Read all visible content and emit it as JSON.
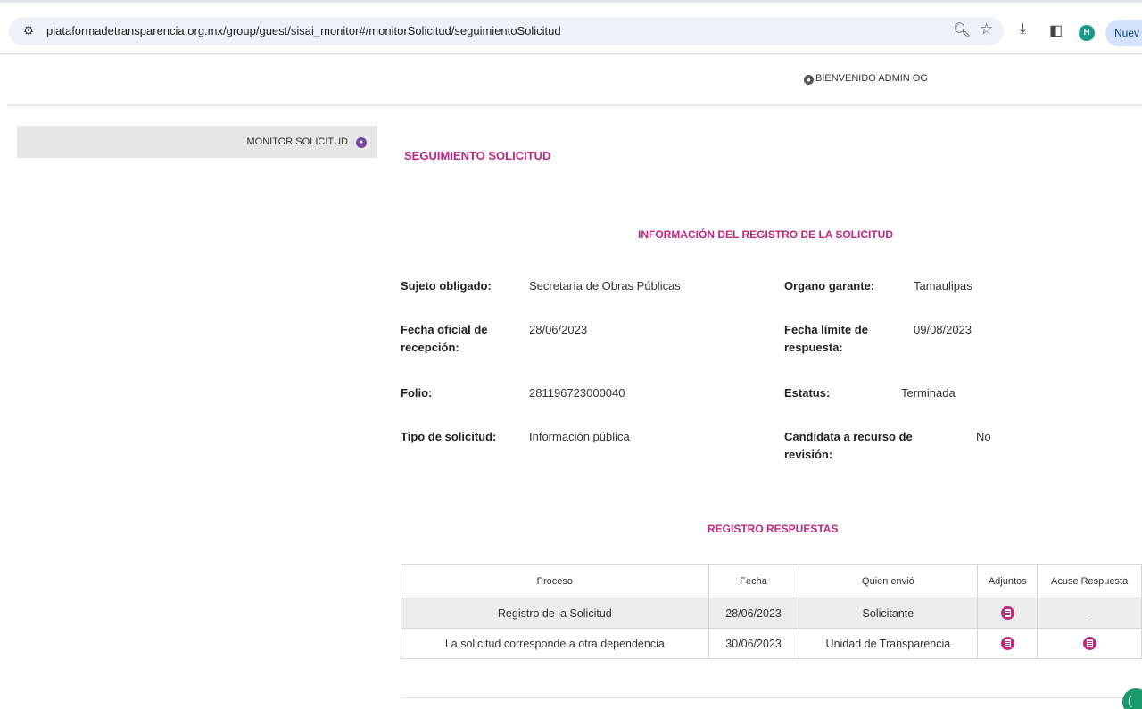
{
  "browser": {
    "url": "plataformadetransparencia.org.mx/group/guest/sisai_monitor#/monitorSolicitud/seguimientoSolicitud",
    "profile_initial": "H",
    "new_button_label": "Nuev"
  },
  "header": {
    "welcome": "BIENVENIDO ADMIN OG"
  },
  "sidebar": {
    "items": [
      {
        "label": "MONITOR SOLICITUD"
      }
    ]
  },
  "main": {
    "title": "SEGUIMIENTO SOLICITUD",
    "info_title": "INFORMACIÓN DEL REGISTRO DE LA SOLICITUD",
    "fields": {
      "sujeto_obligado": {
        "label": "Sujeto obligado:",
        "value": "Secretaría de Obras Públicas"
      },
      "organo_garante": {
        "label": "Organo garante:",
        "value": "Tamaulipas"
      },
      "fecha_oficial": {
        "label": "Fecha oficial de recepción:",
        "value": "28/06/2023"
      },
      "fecha_limite": {
        "label": "Fecha límite de respuesta:",
        "value": "09/08/2023"
      },
      "folio": {
        "label": "Folio:",
        "value": "281196723000040"
      },
      "estatus": {
        "label": "Estatus:",
        "value": "Terminada"
      },
      "tipo_solicitud": {
        "label": "Tipo de solicitud:",
        "value": "Información pública"
      },
      "candidata_recurso": {
        "label": "Candidata a recurso de revisión:",
        "value": "No"
      }
    },
    "responses_title": "REGISTRO RESPUESTAS",
    "table": {
      "columns": [
        "Proceso",
        "Fecha",
        "Quien envió",
        "Adjuntos",
        "Acuse Respuesta"
      ],
      "rows": [
        {
          "proceso": "Registro de la Solicitud",
          "fecha": "28/06/2023",
          "quien": "Solicitante",
          "adjuntos": "file-icon",
          "acuse": "-"
        },
        {
          "proceso": "La solicitud corresponde a otra dependencia",
          "fecha": "30/06/2023",
          "quien": "Unidad de Transparencia",
          "adjuntos": "file-icon",
          "acuse": "file-icon"
        }
      ]
    }
  },
  "colors": {
    "accent": "#c0267f",
    "sidebar_bg": "#e6e6e6",
    "row_alt": "#ececec"
  }
}
